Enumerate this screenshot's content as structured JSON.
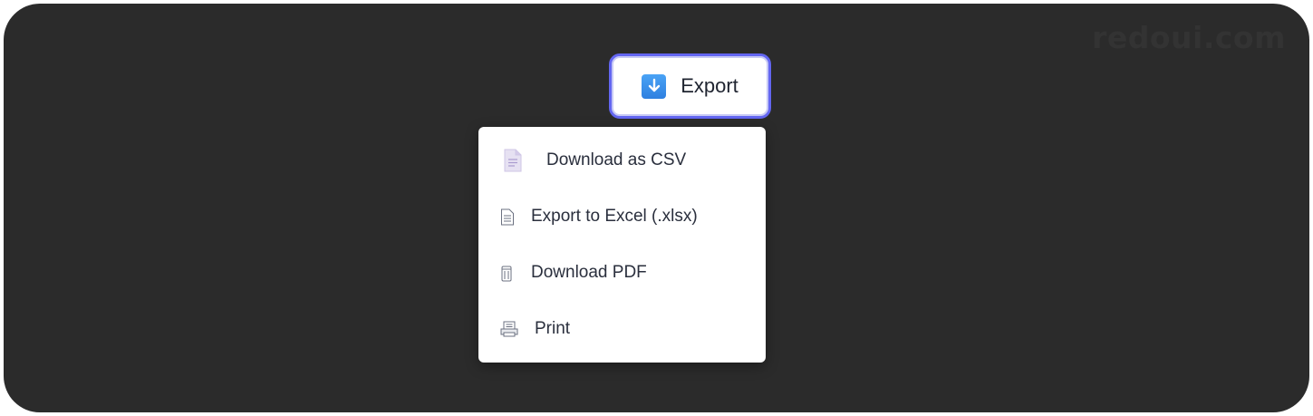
{
  "watermark": "redoui.com",
  "export_button": {
    "label": "Export",
    "icon": "download-arrow-icon",
    "border_color": "#6366f1"
  },
  "menu": {
    "items": [
      {
        "label": "Download as CSV",
        "icon": "document-icon"
      },
      {
        "label": "Export to Excel (.xlsx)",
        "icon": "spreadsheet-file-icon"
      },
      {
        "label": "Download PDF",
        "icon": "pdf-file-icon"
      },
      {
        "label": "Print",
        "icon": "printer-icon"
      }
    ]
  },
  "colors": {
    "background": "#2b2b2b",
    "menu_text": "#2a2f3d",
    "accent": "#6366f1"
  }
}
